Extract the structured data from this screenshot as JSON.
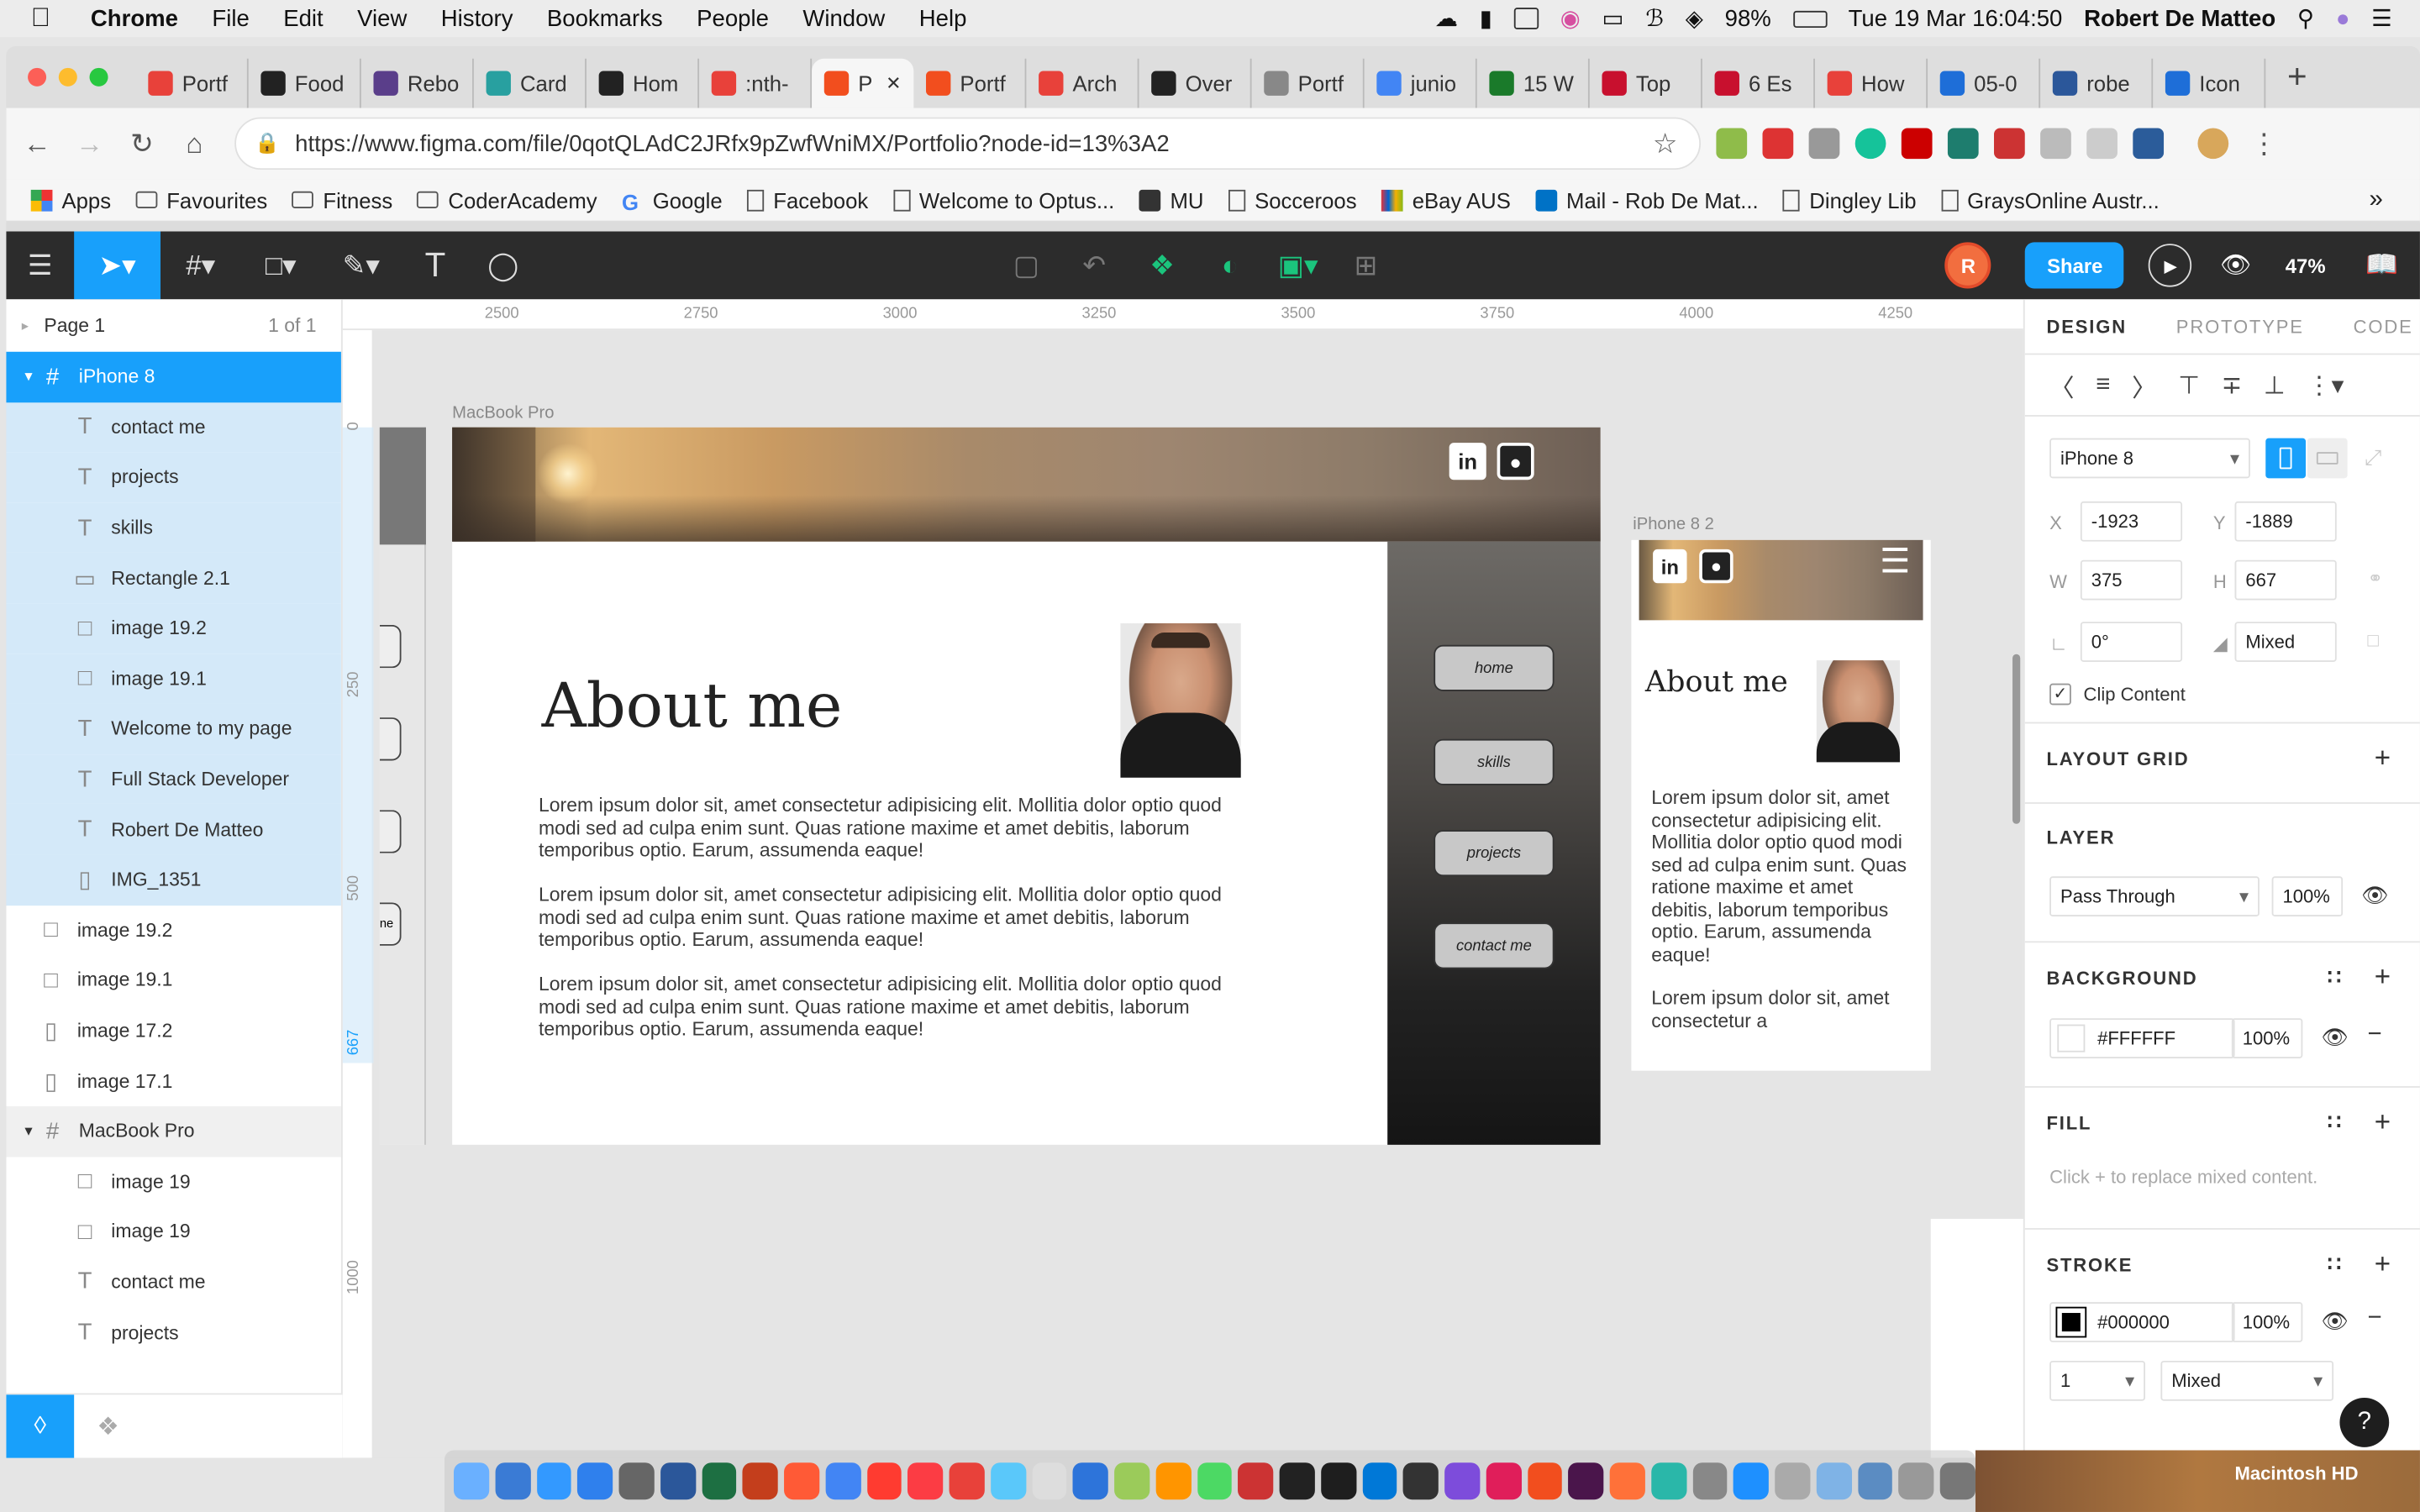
{
  "menubar": {
    "app": "Chrome",
    "items": [
      "File",
      "Edit",
      "View",
      "History",
      "Bookmarks",
      "People",
      "Window",
      "Help"
    ],
    "battery": "98%",
    "datetime": "Tue 19 Mar  16:04:50",
    "user": "Robert De Matteo"
  },
  "tabs": [
    {
      "label": "Portf",
      "color": "#e8413a"
    },
    {
      "label": "Food",
      "color": "#222222"
    },
    {
      "label": "Rebo",
      "color": "#5a3e8a"
    },
    {
      "label": "Card",
      "color": "#28a0a0"
    },
    {
      "label": "Hom",
      "color": "#222222"
    },
    {
      "label": ":nth-",
      "color": "#e8413a"
    },
    {
      "label": "P",
      "color": "#f24e1e",
      "active": true
    },
    {
      "label": "Portf",
      "color": "#f24e1e"
    },
    {
      "label": "Arch",
      "color": "#e8413a"
    },
    {
      "label": "Over",
      "color": "#222222"
    },
    {
      "label": "Portf",
      "color": "#888888"
    },
    {
      "label": "junio",
      "color": "#4285f4"
    },
    {
      "label": "15 W",
      "color": "#1a7a2a"
    },
    {
      "label": "Top",
      "color": "#c8102e"
    },
    {
      "label": "6 Es",
      "color": "#c8102e"
    },
    {
      "label": "How",
      "color": "#e8413a"
    },
    {
      "label": "05-0",
      "color": "#1e6ed8"
    },
    {
      "label": "robe",
      "color": "#2b579a"
    },
    {
      "label": "Icon",
      "color": "#1e6ed8"
    }
  ],
  "address": {
    "url": "https://www.figma.com/file/0qotQLAdC2JRfx9pZwfWniMX/Portfolio?node-id=13%3A2"
  },
  "bookmarks": [
    "Apps",
    "Favourites",
    "Fitness",
    "CoderAcademy",
    "Google",
    "Facebook",
    "Welcome to Optus...",
    "MU",
    "Socceroos",
    "eBay AUS",
    "Mail - Rob De Mat...",
    "Dingley Lib",
    "GraysOnline Austr..."
  ],
  "figma": {
    "zoom": "47%",
    "share_label": "Share",
    "avatar_letter": "R",
    "accent": "#18a0fb"
  },
  "layers": {
    "page_name": "Page 1",
    "page_count": "1 of 1",
    "items": [
      {
        "label": "iPhone 8",
        "kind": "frame",
        "level": 0,
        "selected": true,
        "header": true
      },
      {
        "label": "contact me",
        "kind": "text",
        "level": 1,
        "selected": true
      },
      {
        "label": "projects",
        "kind": "text",
        "level": 1,
        "selected": true
      },
      {
        "label": "skills",
        "kind": "text",
        "level": 1,
        "selected": true
      },
      {
        "label": "Rectangle 2.1",
        "kind": "rect",
        "level": 1,
        "selected": true
      },
      {
        "label": "image 19.2",
        "kind": "image",
        "level": 1,
        "selected": true
      },
      {
        "label": "image 19.1",
        "kind": "image",
        "level": 1,
        "selected": true
      },
      {
        "label": "Welcome to my page",
        "kind": "text",
        "level": 1,
        "selected": true
      },
      {
        "label": "Full Stack Developer",
        "kind": "text",
        "level": 1,
        "selected": true
      },
      {
        "label": "Robert De Matteo",
        "kind": "text",
        "level": 1,
        "selected": true
      },
      {
        "label": "IMG_1351",
        "kind": "image-tall",
        "level": 1,
        "selected": true
      },
      {
        "label": "image 19.2",
        "kind": "image",
        "level": 0,
        "selected": false
      },
      {
        "label": "image 19.1",
        "kind": "image",
        "level": 0,
        "selected": false
      },
      {
        "label": "image 17.2",
        "kind": "image-tall",
        "level": 0,
        "selected": false
      },
      {
        "label": "image 17.1",
        "kind": "image-tall",
        "level": 0,
        "selected": false
      },
      {
        "label": "MacBook Pro",
        "kind": "frame",
        "level": 0,
        "selected": false,
        "header": true
      },
      {
        "label": "image 19",
        "kind": "image",
        "level": 1,
        "selected": false
      },
      {
        "label": "image 19",
        "kind": "image",
        "level": 1,
        "selected": false
      },
      {
        "label": "contact me",
        "kind": "text",
        "level": 1,
        "selected": false
      },
      {
        "label": "projects",
        "kind": "text",
        "level": 1,
        "selected": false
      }
    ]
  },
  "ruler": {
    "top": [
      "2500",
      "2750",
      "3000",
      "3250",
      "3500",
      "3750",
      "4000",
      "4250"
    ],
    "left": [
      "0",
      "250",
      "500",
      "667",
      "1000",
      "250"
    ]
  },
  "artboards": {
    "macbook": {
      "label": "MacBook Pro",
      "heading": "About me",
      "paragraphs": [
        "Lorem ipsum dolor sit, amet consectetur adipisicing elit. Mollitia dolor optio quod modi sed ad culpa enim sunt. Quas ratione maxime et amet debitis, laborum temporibus optio. Earum, assumenda eaque!",
        "Lorem ipsum dolor sit, amet consectetur adipisicing elit. Mollitia dolor optio quod modi sed ad culpa enim sunt. Quas ratione maxime et amet debitis, laborum temporibus optio. Earum, assumenda eaque!",
        "Lorem ipsum dolor sit, amet consectetur adipisicing elit. Mollitia dolor optio quod modi sed ad culpa enim sunt. Quas ratione maxime et amet debitis, laborum temporibus optio. Earum, assumenda eaque!"
      ],
      "nav": [
        "home",
        "skills",
        "projects",
        "contact me"
      ],
      "side_label": "ne"
    },
    "iphone": {
      "label": "iPhone 8 2",
      "heading": "About me",
      "paragraph1": "Lorem ipsum dolor sit, amet consectetur adipisicing elit. Mollitia dolor optio quod modi sed ad culpa enim sunt. Quas ratione maxime et amet debitis, laborum temporibus optio. Earum, assumenda eaque!",
      "paragraph2": "Lorem ipsum dolor sit, amet consectetur a"
    }
  },
  "design": {
    "tabs": [
      "DESIGN",
      "PROTOTYPE",
      "CODE"
    ],
    "frame_preset": "iPhone 8",
    "x": "-1923",
    "y": "-1889",
    "w": "375",
    "h": "667",
    "rotation": "0°",
    "radius": "Mixed",
    "clip_content": "Clip Content",
    "sections": {
      "layout_grid": "LAYOUT GRID",
      "layer": "LAYER",
      "background": "BACKGROUND",
      "fill": "FILL",
      "stroke": "STROKE"
    },
    "blend": "Pass Through",
    "layer_opacity": "100%",
    "bg_hex": "#FFFFFF",
    "bg_opacity": "100%",
    "fill_hint": "Click + to replace mixed content.",
    "stroke_hex": "#000000",
    "stroke_opacity": "100%",
    "stroke_weight": "1",
    "stroke_align": "Mixed"
  },
  "dock": {
    "disk_label": "Macintosh HD"
  }
}
